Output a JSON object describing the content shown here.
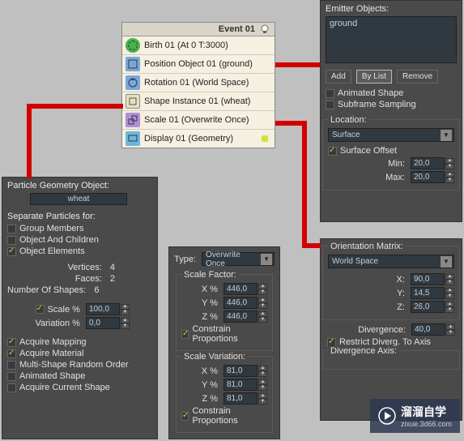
{
  "event": {
    "header": "Event 01",
    "rows": [
      {
        "label": "Birth 01 (At 0 T:3000)"
      },
      {
        "label": "Position Object 01 (ground)"
      },
      {
        "label": "Rotation 01 (World Space)"
      },
      {
        "label": "Shape Instance 01 (wheat)"
      },
      {
        "label": "Scale 01 (Overwrite Once)"
      },
      {
        "label": "Display 01 (Geometry)"
      }
    ]
  },
  "emitter": {
    "header": "Emitter Objects:",
    "item": "ground",
    "add": "Add",
    "bylist": "By List",
    "remove": "Remove",
    "animated": "Animated Shape",
    "subframe": "Subframe Sampling",
    "location_header": "Location:",
    "location_value": "Surface",
    "surface_offset": "Surface Offset",
    "min_label": "Min:",
    "min_value": "20,0",
    "max_label": "Max:",
    "max_value": "20,0"
  },
  "orientation": {
    "header": "Orientation Matrix:",
    "value": "World Space",
    "x_label": "X:",
    "x_val": "90,0",
    "y_label": "Y:",
    "y_val": "14,5",
    "z_label": "Z:",
    "z_val": "26,0",
    "div_label": "Divergence:",
    "div_val": "40,0",
    "restrict": "Restrict Diverg. To Axis",
    "axis_header": "Divergence Axis:"
  },
  "shape": {
    "header": "Particle Geometry Object:",
    "value": "wheat",
    "separate_header": "Separate Particles for:",
    "group": "Group Members",
    "children": "Object And Children",
    "elements": "Object Elements",
    "vertices_label": "Vertices:",
    "vertices_val": "4",
    "faces_label": "Faces:",
    "faces_val": "2",
    "shapes_label": "Number Of Shapes:",
    "shapes_val": "6",
    "scale_label": "Scale %",
    "scale_val": "100,0",
    "variation_label": "Variation %",
    "variation_val": "0,0",
    "acq_mapping": "Acquire Mapping",
    "acq_material": "Acquire Material",
    "multishape": "Multi-Shape Random Order",
    "anim_shape": "Animated Shape",
    "acq_current": "Acquire Current Shape"
  },
  "scale": {
    "type_label": "Type:",
    "type_value": "Overwrite Once",
    "factor_header": "Scale Factor:",
    "x_label": "X %",
    "x_val": "446,0",
    "y_label": "Y %",
    "y_val": "446,0",
    "z_label": "Z %",
    "z_val": "446,0",
    "constrain": "Constrain Proportions",
    "variation_header": "Scale Variation:",
    "vx_label": "X %",
    "vx_val": "81,0",
    "vy_label": "Y %",
    "vy_val": "81,0",
    "vz_label": "Z %",
    "vz_val": "81,0",
    "vconstrain": "Constrain Proportions"
  },
  "watermark": {
    "text1": "溜溜自学",
    "text2": "zixue.3d66.com"
  }
}
